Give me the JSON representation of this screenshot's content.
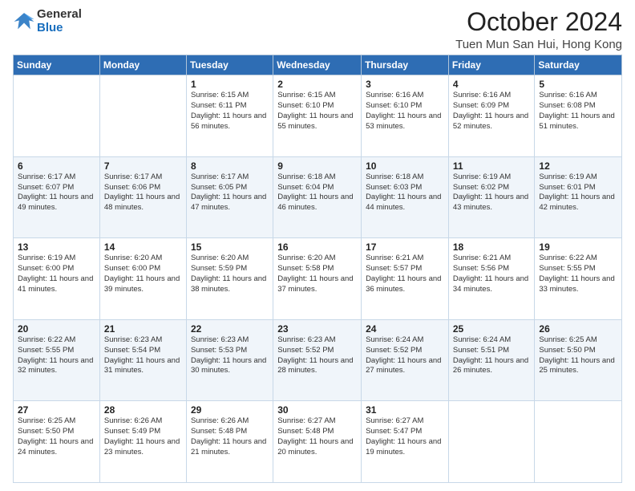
{
  "logo": {
    "general": "General",
    "blue": "Blue"
  },
  "title": {
    "month_year": "October 2024",
    "location": "Tuen Mun San Hui, Hong Kong"
  },
  "weekdays": [
    "Sunday",
    "Monday",
    "Tuesday",
    "Wednesday",
    "Thursday",
    "Friday",
    "Saturday"
  ],
  "weeks": [
    [
      {
        "day": "",
        "sunrise": "",
        "sunset": "",
        "daylight": ""
      },
      {
        "day": "",
        "sunrise": "",
        "sunset": "",
        "daylight": ""
      },
      {
        "day": "1",
        "sunrise": "Sunrise: 6:15 AM",
        "sunset": "Sunset: 6:11 PM",
        "daylight": "Daylight: 11 hours and 56 minutes."
      },
      {
        "day": "2",
        "sunrise": "Sunrise: 6:15 AM",
        "sunset": "Sunset: 6:10 PM",
        "daylight": "Daylight: 11 hours and 55 minutes."
      },
      {
        "day": "3",
        "sunrise": "Sunrise: 6:16 AM",
        "sunset": "Sunset: 6:10 PM",
        "daylight": "Daylight: 11 hours and 53 minutes."
      },
      {
        "day": "4",
        "sunrise": "Sunrise: 6:16 AM",
        "sunset": "Sunset: 6:09 PM",
        "daylight": "Daylight: 11 hours and 52 minutes."
      },
      {
        "day": "5",
        "sunrise": "Sunrise: 6:16 AM",
        "sunset": "Sunset: 6:08 PM",
        "daylight": "Daylight: 11 hours and 51 minutes."
      }
    ],
    [
      {
        "day": "6",
        "sunrise": "Sunrise: 6:17 AM",
        "sunset": "Sunset: 6:07 PM",
        "daylight": "Daylight: 11 hours and 49 minutes."
      },
      {
        "day": "7",
        "sunrise": "Sunrise: 6:17 AM",
        "sunset": "Sunset: 6:06 PM",
        "daylight": "Daylight: 11 hours and 48 minutes."
      },
      {
        "day": "8",
        "sunrise": "Sunrise: 6:17 AM",
        "sunset": "Sunset: 6:05 PM",
        "daylight": "Daylight: 11 hours and 47 minutes."
      },
      {
        "day": "9",
        "sunrise": "Sunrise: 6:18 AM",
        "sunset": "Sunset: 6:04 PM",
        "daylight": "Daylight: 11 hours and 46 minutes."
      },
      {
        "day": "10",
        "sunrise": "Sunrise: 6:18 AM",
        "sunset": "Sunset: 6:03 PM",
        "daylight": "Daylight: 11 hours and 44 minutes."
      },
      {
        "day": "11",
        "sunrise": "Sunrise: 6:19 AM",
        "sunset": "Sunset: 6:02 PM",
        "daylight": "Daylight: 11 hours and 43 minutes."
      },
      {
        "day": "12",
        "sunrise": "Sunrise: 6:19 AM",
        "sunset": "Sunset: 6:01 PM",
        "daylight": "Daylight: 11 hours and 42 minutes."
      }
    ],
    [
      {
        "day": "13",
        "sunrise": "Sunrise: 6:19 AM",
        "sunset": "Sunset: 6:00 PM",
        "daylight": "Daylight: 11 hours and 41 minutes."
      },
      {
        "day": "14",
        "sunrise": "Sunrise: 6:20 AM",
        "sunset": "Sunset: 6:00 PM",
        "daylight": "Daylight: 11 hours and 39 minutes."
      },
      {
        "day": "15",
        "sunrise": "Sunrise: 6:20 AM",
        "sunset": "Sunset: 5:59 PM",
        "daylight": "Daylight: 11 hours and 38 minutes."
      },
      {
        "day": "16",
        "sunrise": "Sunrise: 6:20 AM",
        "sunset": "Sunset: 5:58 PM",
        "daylight": "Daylight: 11 hours and 37 minutes."
      },
      {
        "day": "17",
        "sunrise": "Sunrise: 6:21 AM",
        "sunset": "Sunset: 5:57 PM",
        "daylight": "Daylight: 11 hours and 36 minutes."
      },
      {
        "day": "18",
        "sunrise": "Sunrise: 6:21 AM",
        "sunset": "Sunset: 5:56 PM",
        "daylight": "Daylight: 11 hours and 34 minutes."
      },
      {
        "day": "19",
        "sunrise": "Sunrise: 6:22 AM",
        "sunset": "Sunset: 5:55 PM",
        "daylight": "Daylight: 11 hours and 33 minutes."
      }
    ],
    [
      {
        "day": "20",
        "sunrise": "Sunrise: 6:22 AM",
        "sunset": "Sunset: 5:55 PM",
        "daylight": "Daylight: 11 hours and 32 minutes."
      },
      {
        "day": "21",
        "sunrise": "Sunrise: 6:23 AM",
        "sunset": "Sunset: 5:54 PM",
        "daylight": "Daylight: 11 hours and 31 minutes."
      },
      {
        "day": "22",
        "sunrise": "Sunrise: 6:23 AM",
        "sunset": "Sunset: 5:53 PM",
        "daylight": "Daylight: 11 hours and 30 minutes."
      },
      {
        "day": "23",
        "sunrise": "Sunrise: 6:23 AM",
        "sunset": "Sunset: 5:52 PM",
        "daylight": "Daylight: 11 hours and 28 minutes."
      },
      {
        "day": "24",
        "sunrise": "Sunrise: 6:24 AM",
        "sunset": "Sunset: 5:52 PM",
        "daylight": "Daylight: 11 hours and 27 minutes."
      },
      {
        "day": "25",
        "sunrise": "Sunrise: 6:24 AM",
        "sunset": "Sunset: 5:51 PM",
        "daylight": "Daylight: 11 hours and 26 minutes."
      },
      {
        "day": "26",
        "sunrise": "Sunrise: 6:25 AM",
        "sunset": "Sunset: 5:50 PM",
        "daylight": "Daylight: 11 hours and 25 minutes."
      }
    ],
    [
      {
        "day": "27",
        "sunrise": "Sunrise: 6:25 AM",
        "sunset": "Sunset: 5:50 PM",
        "daylight": "Daylight: 11 hours and 24 minutes."
      },
      {
        "day": "28",
        "sunrise": "Sunrise: 6:26 AM",
        "sunset": "Sunset: 5:49 PM",
        "daylight": "Daylight: 11 hours and 23 minutes."
      },
      {
        "day": "29",
        "sunrise": "Sunrise: 6:26 AM",
        "sunset": "Sunset: 5:48 PM",
        "daylight": "Daylight: 11 hours and 21 minutes."
      },
      {
        "day": "30",
        "sunrise": "Sunrise: 6:27 AM",
        "sunset": "Sunset: 5:48 PM",
        "daylight": "Daylight: 11 hours and 20 minutes."
      },
      {
        "day": "31",
        "sunrise": "Sunrise: 6:27 AM",
        "sunset": "Sunset: 5:47 PM",
        "daylight": "Daylight: 11 hours and 19 minutes."
      },
      {
        "day": "",
        "sunrise": "",
        "sunset": "",
        "daylight": ""
      },
      {
        "day": "",
        "sunrise": "",
        "sunset": "",
        "daylight": ""
      }
    ]
  ]
}
